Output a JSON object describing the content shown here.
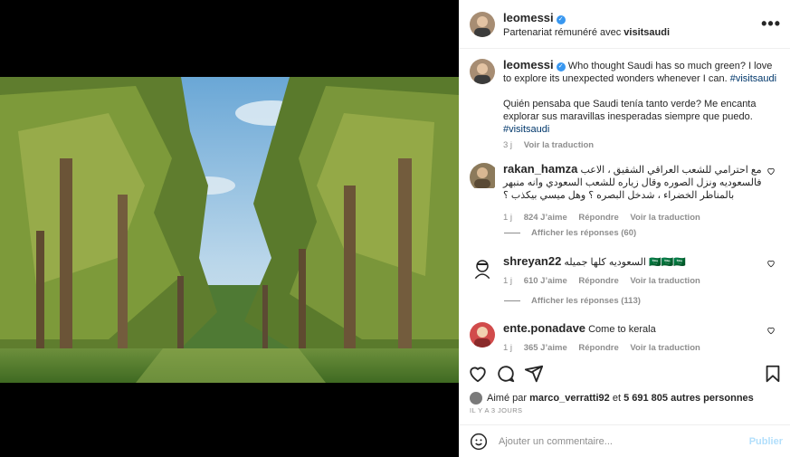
{
  "post": {
    "author": "leomessi",
    "sponsor_prefix": "Partenariat rémunéré avec",
    "sponsor": "visitsaudi",
    "more_label": "•••"
  },
  "caption": {
    "user": "leomessi",
    "text_en": "Who thought Saudi has so much green? I love to explore its unexpected wonders whenever I can.",
    "tag_en": "#visitsaudi",
    "text_es": "Quién pensaba que Saudi tenía tanto verde? Me encanta explorar sus maravillas inesperadas siempre que puedo.",
    "tag_es": "#visitsaudi",
    "time": "3 j",
    "translate": "Voir la traduction"
  },
  "comments": [
    {
      "user": "rakan_hamza",
      "text": "مع احترامي للشعب العراقي الشقيق ، الاعب فالسعوديه ونزل الصوره وقال زياره للشعب السعودي وانه منبهر بالمناظر الخضراء ، شدخل البصره ؟ وهل ميسي بيكذب ؟",
      "time": "1 j",
      "likes": "824 J’aime",
      "reply": "Répondre",
      "translate": "Voir la traduction",
      "replies": "Afficher les réponses (60)"
    },
    {
      "user": "shreyan22",
      "text": "السعوديه كلها جميله 🇸🇦🇸🇦🇸🇦",
      "time": "1 j",
      "likes": "610 J’aime",
      "reply": "Répondre",
      "translate": "Voir la traduction",
      "replies": "Afficher les réponses (113)"
    },
    {
      "user": "ente.ponadave",
      "text": "Come to kerala",
      "time": "1 j",
      "likes": "365 J’aime",
      "reply": "Répondre",
      "translate": "Voir la traduction"
    }
  ],
  "likes_bar": {
    "prefix": "Aimé par",
    "user": "marco_verratti92",
    "middle": "et",
    "count": "5 691 805 autres personnes"
  },
  "date": "IL Y A 3 JOURS",
  "add_comment": {
    "placeholder": "Ajouter un commentaire...",
    "post_label": "Publier"
  },
  "icons": [
    "more-icon",
    "verified-icon",
    "heart-icon",
    "comment-icon",
    "share-icon",
    "bookmark-icon",
    "emoji-icon"
  ],
  "colors": {
    "verified": "#3897f0",
    "link": "#00376b",
    "muted": "#8e8e8e",
    "post_disabled": "#b2dffc"
  }
}
